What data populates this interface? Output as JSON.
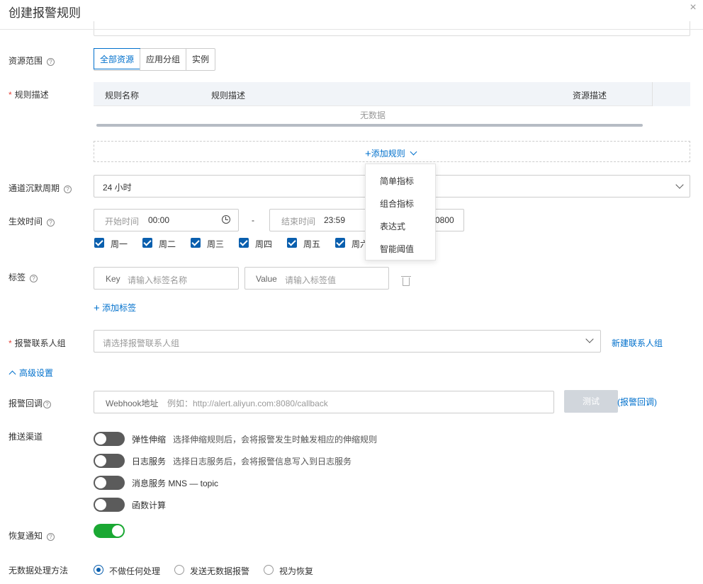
{
  "dialog": {
    "title": "创建报警规则",
    "close_icon": "×"
  },
  "resource_scope": {
    "label": "资源范围",
    "options": [
      "全部资源",
      "应用分组",
      "实例"
    ],
    "selected": "全部资源"
  },
  "rule_desc": {
    "label": "规则描述",
    "columns": [
      "规则名称",
      "规则描述",
      "资源描述"
    ],
    "empty_text": "无数据",
    "add_rule_label": "添加规则",
    "dropdown_items": [
      "简单指标",
      "组合指标",
      "表达式",
      "智能阈值"
    ]
  },
  "silence_period": {
    "label": "通道沉默周期",
    "value": "24 小时"
  },
  "effective_time": {
    "label": "生效时间",
    "start_placeholder": "开始时间",
    "start_value": "00:00",
    "separator": "-",
    "end_placeholder": "结束时间",
    "end_value": "23:59",
    "timezone_partial": "0800",
    "weekdays": [
      "周一",
      "周二",
      "周三",
      "周四",
      "周五",
      "周六"
    ]
  },
  "tags": {
    "label": "标签",
    "key_prefix": "Key",
    "key_placeholder": "请输入标签名称",
    "value_prefix": "Value",
    "value_placeholder": "请输入标签值",
    "add_tag_label": "添加标签"
  },
  "contact_group": {
    "label": "报警联系人组",
    "placeholder": "请选择报警联系人组",
    "new_group_label": "新建联系人组"
  },
  "advanced": {
    "label": "高级设置"
  },
  "callback": {
    "label": "报警回调",
    "prefix": "Webhook地址",
    "placeholder": "例如：http://alert.aliyun.com:8080/callback",
    "test_label": "测试",
    "link_label": "(报警回调)"
  },
  "push_channel": {
    "label": "推送渠道",
    "items": [
      {
        "name": "弹性伸缩",
        "desc": "选择伸缩规则后，会将报警发生时触发相应的伸缩规则",
        "on": false
      },
      {
        "name": "日志服务",
        "desc": "选择日志服务后，会将报警信息写入到日志服务",
        "on": false
      },
      {
        "name": "消息服务 MNS — topic",
        "desc": "",
        "on": false
      },
      {
        "name": "函数计算",
        "desc": "",
        "on": false
      }
    ]
  },
  "recovery_notice": {
    "label": "恢复通知",
    "on": true
  },
  "no_data": {
    "label": "无数据处理方法",
    "options": [
      "不做任何处理",
      "发送无数据报警",
      "视为恢复"
    ],
    "selected": "不做任何处理"
  },
  "colors": {
    "accent": "#0070cc",
    "checkbox": "#0a5fae",
    "toggle_on": "#1aa833",
    "toggle_off": "#5b5b5b",
    "required": "#e5443a"
  }
}
